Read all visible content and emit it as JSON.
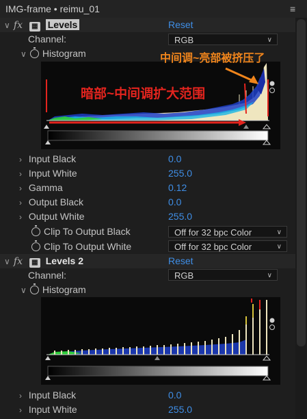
{
  "window": {
    "title": "IMG-frame • reimu_01",
    "menu_icon": "hamburger-menu-icon"
  },
  "effects": [
    {
      "name": "Levels",
      "reset_label": "Reset",
      "channel_label": "Channel:",
      "channel_value": "RGB",
      "histogram_label": "Histogram",
      "params": [
        {
          "label": "Input Black",
          "value": "0.0"
        },
        {
          "label": "Input White",
          "value": "255.0"
        },
        {
          "label": "Gamma",
          "value": "0.12"
        },
        {
          "label": "Output Black",
          "value": "0.0"
        },
        {
          "label": "Output White",
          "value": "255.0"
        }
      ],
      "clip_black_label": "Clip To Output Black",
      "clip_black_value": "Off for 32 bpc Color",
      "clip_white_label": "Clip To Output White",
      "clip_white_value": "Off for 32 bpc Color"
    },
    {
      "name": "Levels 2",
      "reset_label": "Reset",
      "channel_label": "Channel:",
      "channel_value": "RGB",
      "histogram_label": "Histogram",
      "params": [
        {
          "label": "Input Black",
          "value": "0.0"
        },
        {
          "label": "Input White",
          "value": "255.0"
        }
      ]
    }
  ],
  "annotations": {
    "red_text": "暗部~中间调扩大范围",
    "orange_text": "中间调~亮部被挤压了",
    "red_color": "#e3241e",
    "orange_color": "#f0851c"
  },
  "colors": {
    "accent": "#3f8ee6",
    "background": "#1e1e1e"
  }
}
